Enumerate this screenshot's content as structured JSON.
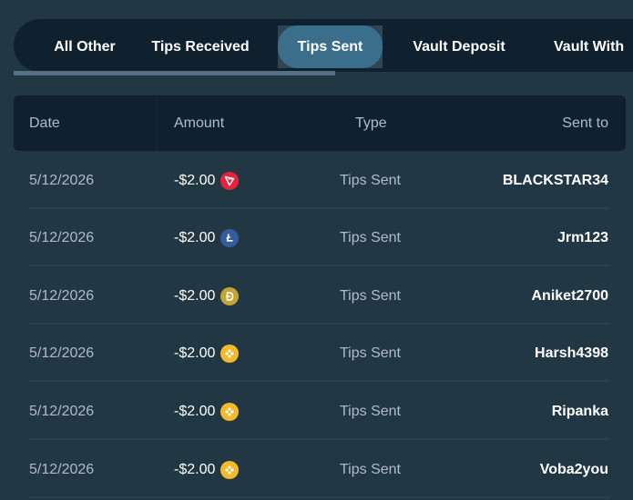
{
  "tabs": [
    {
      "label": "All Other",
      "active": false
    },
    {
      "label": "Tips Received",
      "active": false
    },
    {
      "label": "Tips Sent",
      "active": true
    },
    {
      "label": "Vault Deposit",
      "active": false
    },
    {
      "label": "Vault With",
      "active": false
    }
  ],
  "table": {
    "headers": {
      "date": "Date",
      "amount": "Amount",
      "type": "Type",
      "sent_to": "Sent to"
    },
    "rows": [
      {
        "date": "5/12/2026",
        "amount": "-$2.00",
        "coin": "tron-icon",
        "type": "Tips Sent",
        "sent_to": "BLACKSTAR34"
      },
      {
        "date": "5/12/2026",
        "amount": "-$2.00",
        "coin": "litecoin-icon",
        "type": "Tips Sent",
        "sent_to": "Jrm123"
      },
      {
        "date": "5/12/2026",
        "amount": "-$2.00",
        "coin": "dogecoin-icon",
        "type": "Tips Sent",
        "sent_to": "Aniket2700"
      },
      {
        "date": "5/12/2026",
        "amount": "-$2.00",
        "coin": "bnb-icon",
        "type": "Tips Sent",
        "sent_to": "Harsh4398"
      },
      {
        "date": "5/12/2026",
        "amount": "-$2.00",
        "coin": "bnb-icon",
        "type": "Tips Sent",
        "sent_to": "Ripanka"
      },
      {
        "date": "5/12/2026",
        "amount": "-$2.00",
        "coin": "bnb-icon",
        "type": "Tips Sent",
        "sent_to": "Voba2you"
      }
    ]
  },
  "colors": {
    "background": "#213743",
    "tab_bar": "#0f212e",
    "active_tab": "#3a6e8a",
    "header_row": "#0f212e",
    "muted_text": "#b1bad3",
    "tron": "#e5243b",
    "litecoin": "#345d9d",
    "dogecoin": "#c2a633",
    "bnb": "#f3ba2f"
  }
}
